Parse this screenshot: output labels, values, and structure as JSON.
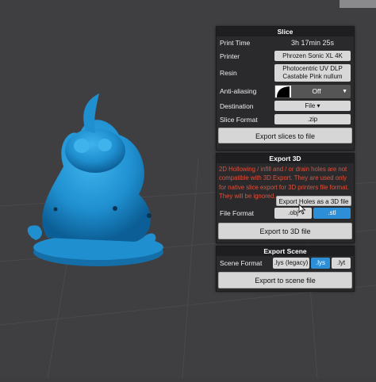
{
  "slice": {
    "header": "Slice",
    "print_time_label": "Print Time",
    "print_time_value": "3h 17min 25s",
    "printer_label": "Printer",
    "printer_value": "Phrozen Sonic XL 4K",
    "resin_label": "Resin",
    "resin_line1": "Photocentric UV DLP",
    "resin_line2": "Castable Pink nullum",
    "aa_label": "Anti-aliasing",
    "aa_value": "Off",
    "destination_label": "Destination",
    "destination_value": "File ▾",
    "format_label": "Slice Format",
    "format_value": ".zip",
    "export_button": "Export slices to file"
  },
  "export3d": {
    "header": "Export 3D",
    "warning": "2D Hollowing / infill and / or drain holes are not compatible with 3D Export. They are used only for native slice export for 3D printers file format. They will be ignored.",
    "holes_button": "Export Holes as a 3D file",
    "format_label": "File Format",
    "formats": [
      ".obj",
      ".stl"
    ],
    "selected_format": ".stl",
    "export_button": "Export to 3D file"
  },
  "export_scene": {
    "header": "Export Scene",
    "format_label": "Scene Format",
    "formats": [
      ".lys (legacy)",
      ".lys",
      ".lyt"
    ],
    "selected_format": ".lys",
    "export_button": "Export to scene file"
  },
  "colors": {
    "accent": "#2d8fd8",
    "model": "#1f8fd0",
    "warning": "#e0503a"
  }
}
